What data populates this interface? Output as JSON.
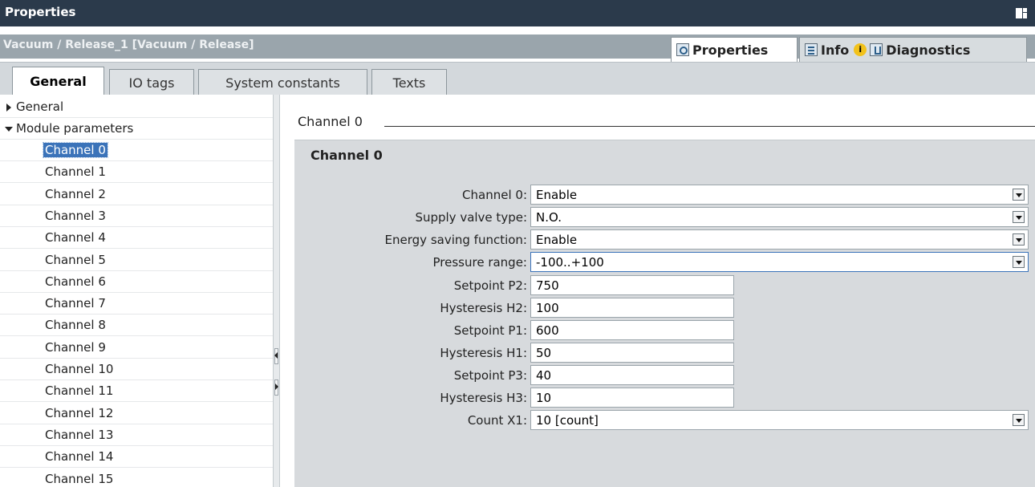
{
  "window": {
    "title": "Properties"
  },
  "object_bar": {
    "object_name": "Vacuum / Release_1 [Vacuum / Release]"
  },
  "inspector_tabs": {
    "properties": "Properties",
    "info": "Info",
    "info_badge": "i",
    "diagnostics": "Diagnostics"
  },
  "sub_tabs": {
    "general": "General",
    "io_tags": "IO tags",
    "system_constants": "System constants",
    "texts": "Texts"
  },
  "tree": {
    "general": "General",
    "module_parameters": "Module parameters",
    "channels": [
      "Channel 0",
      "Channel 1",
      "Channel 2",
      "Channel 3",
      "Channel 4",
      "Channel 5",
      "Channel 6",
      "Channel 7",
      "Channel 8",
      "Channel 9",
      "Channel 10",
      "Channel 11",
      "Channel 12",
      "Channel 13",
      "Channel 14",
      "Channel 15"
    ],
    "selected_index": 0
  },
  "content": {
    "section_heading": "Channel 0",
    "panel_title": "Channel 0",
    "fields": [
      {
        "label": "Channel 0:",
        "value": "Enable",
        "kind": "dropdown"
      },
      {
        "label": "Supply valve type:",
        "value": "N.O.",
        "kind": "dropdown"
      },
      {
        "label": "Energy saving function:",
        "value": "Enable",
        "kind": "dropdown"
      },
      {
        "label": "Pressure range:",
        "value": "-100..+100",
        "kind": "dropdown"
      },
      {
        "label": "Setpoint P2:",
        "value": "750",
        "kind": "text"
      },
      {
        "label": "Hysteresis H2:",
        "value": "100",
        "kind": "text"
      },
      {
        "label": "Setpoint P1:",
        "value": "600",
        "kind": "text"
      },
      {
        "label": "Hysteresis H1:",
        "value": "50",
        "kind": "text"
      },
      {
        "label": "Setpoint P3:",
        "value": "40",
        "kind": "text"
      },
      {
        "label": "Hysteresis H3:",
        "value": "10",
        "kind": "text"
      },
      {
        "label": "Count X1:",
        "value": "10 [count]",
        "kind": "dropdown"
      }
    ]
  },
  "colors": {
    "titlebar": "#2b3a4b",
    "object_bar": "#9aa5ac",
    "selection": "#3b73b9",
    "panel": "#d7dadd",
    "info_badge": "#f2c21b"
  },
  "icons": {
    "properties_tab": "magnifier-icon",
    "info_tab": "info-list-icon",
    "diagnostics_tab": "diagnostics-icon",
    "dock": "dock-window-icon"
  }
}
